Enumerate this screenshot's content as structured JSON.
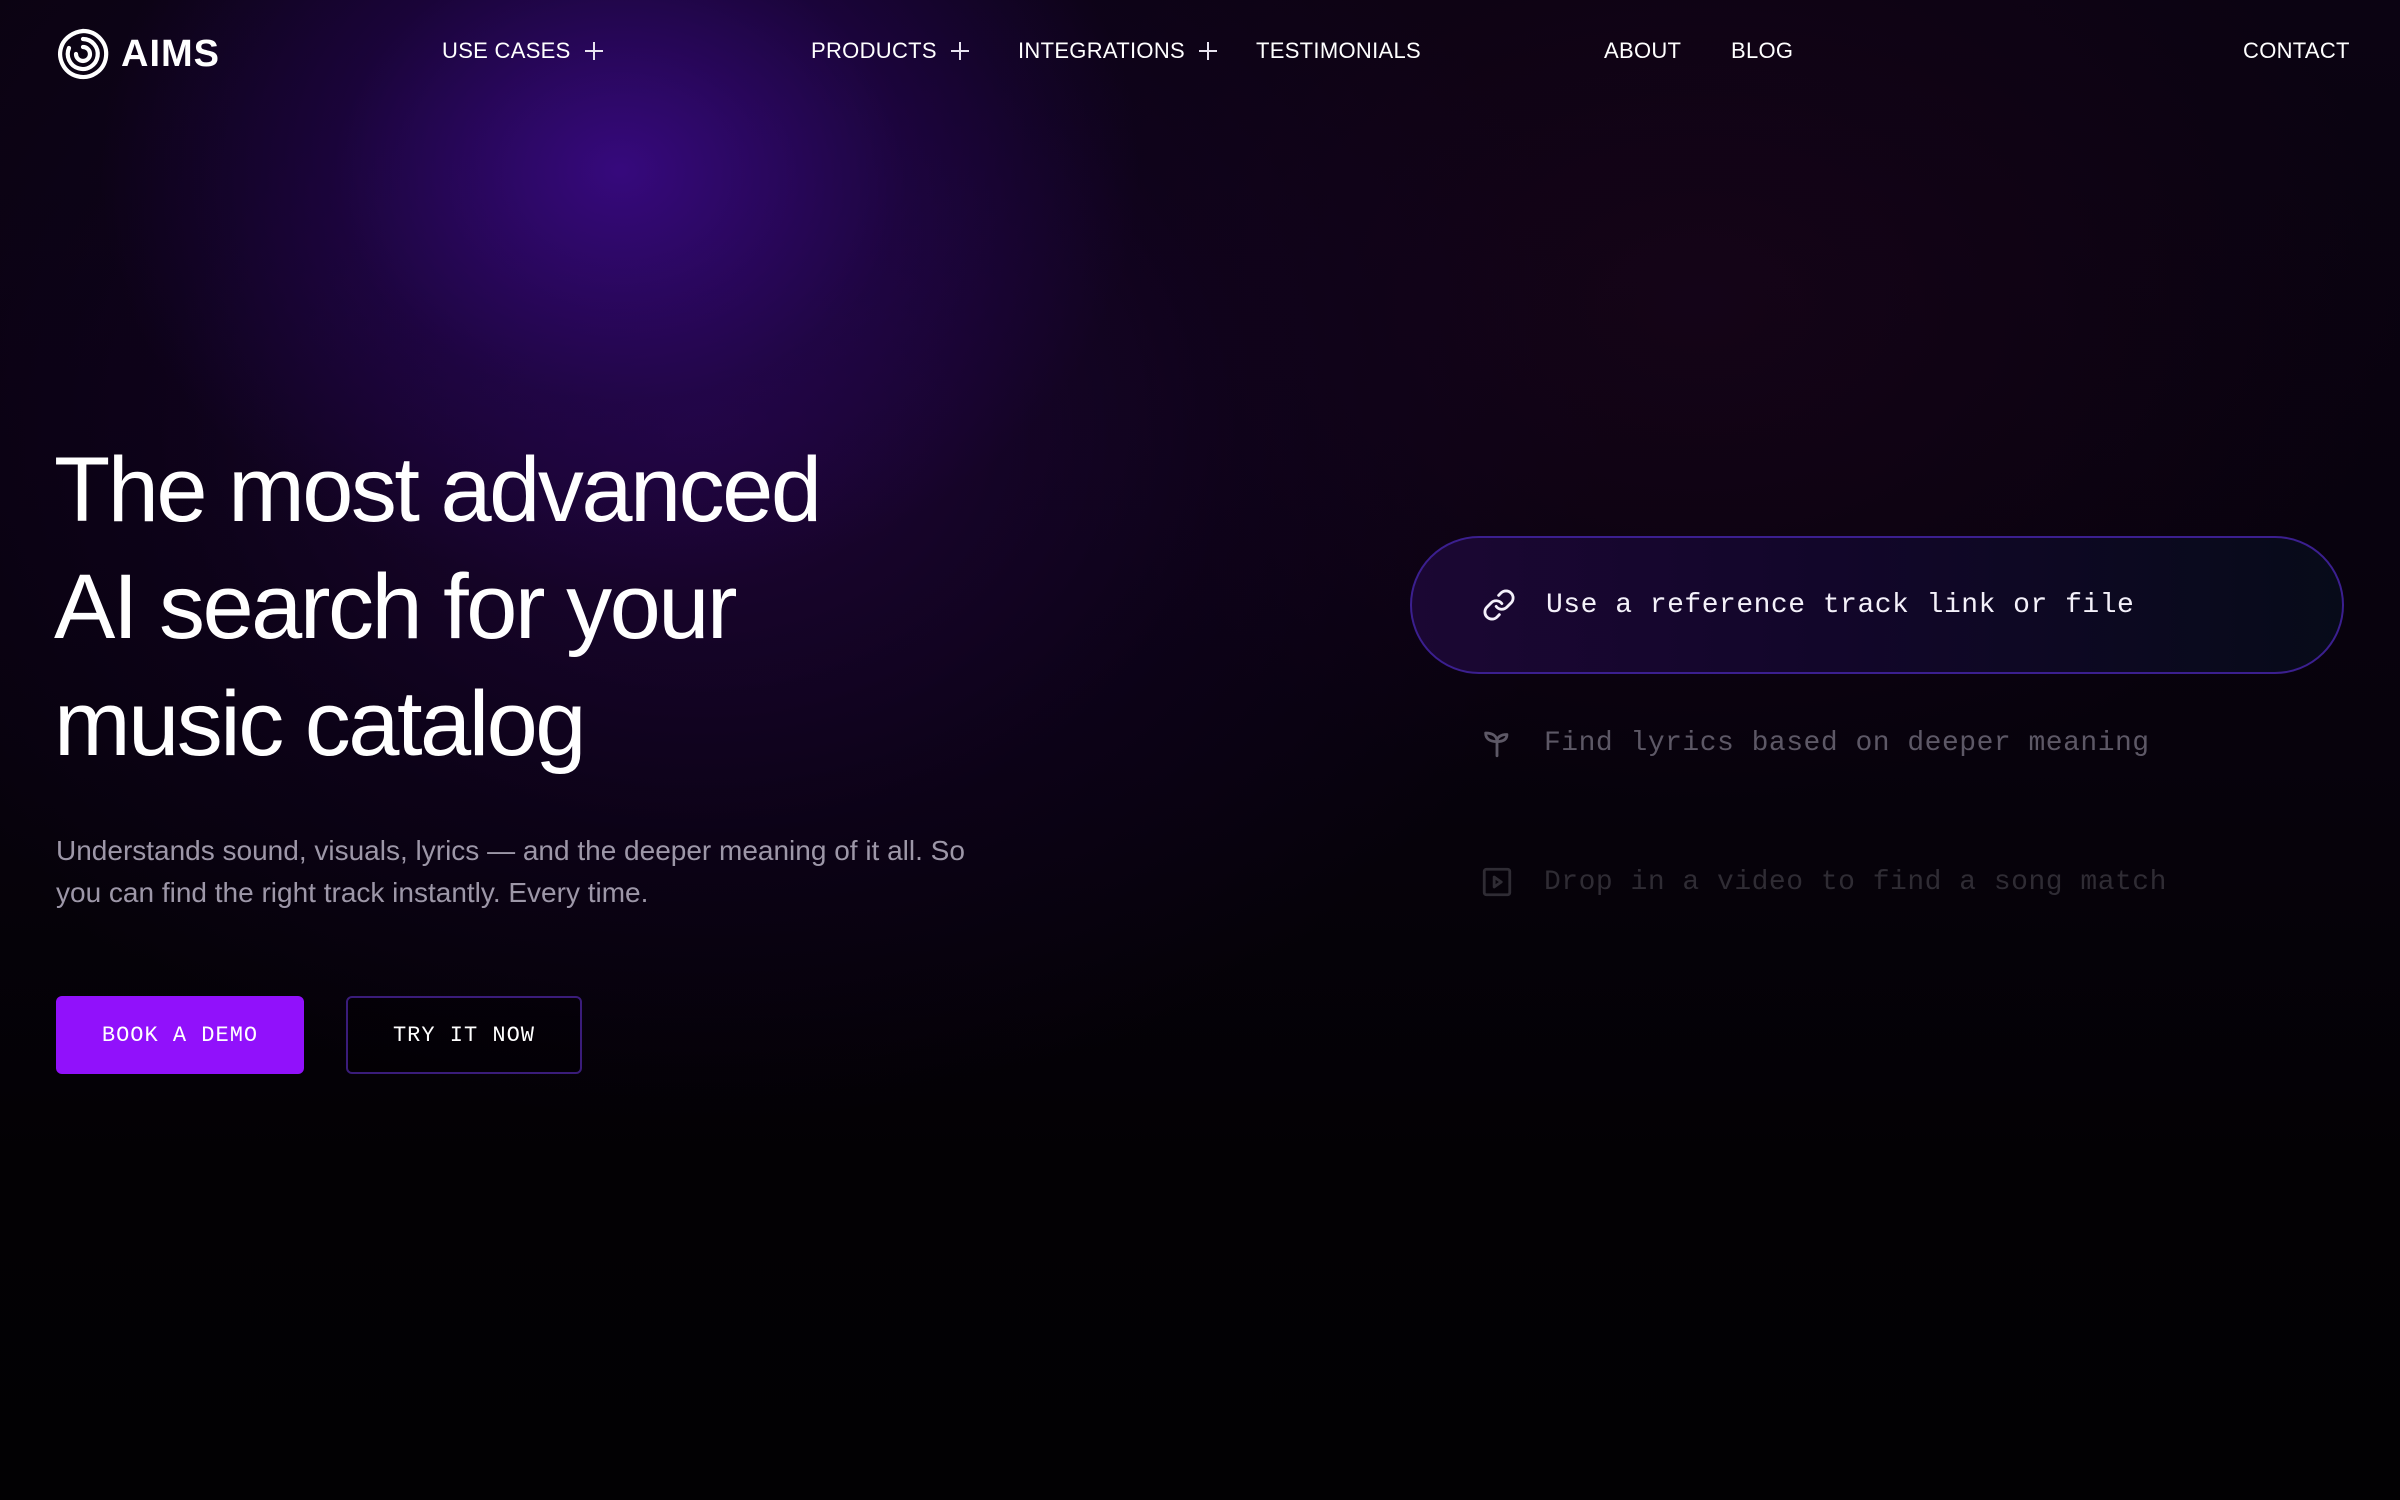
{
  "brand": {
    "name": "AIMS",
    "accent": "#9111fb",
    "logo_icon": "spiral-logo-icon"
  },
  "nav": {
    "items": [
      {
        "label": "USE CASES",
        "icon": "plus-icon"
      },
      {
        "label": "PRODUCTS",
        "icon": "plus-icon"
      },
      {
        "label": "INTEGRATIONS",
        "icon": "plus-icon"
      },
      {
        "label": "TESTIMONIALS"
      },
      {
        "label": "ABOUT"
      },
      {
        "label": "BLOG"
      },
      {
        "label": "CONTACT"
      }
    ]
  },
  "hero": {
    "title_lines": [
      "The most advanced",
      "AI search for your",
      "music catalog"
    ],
    "subtitle": "Understands sound, visuals, lyrics — and the deeper meaning of it all. So you can find the right track instantly. Every time.",
    "primary_cta": "BOOK A DEMO",
    "secondary_cta": "TRY IT NOW"
  },
  "search_options": [
    {
      "label": "Use a reference track link or file",
      "icon": "link-icon",
      "active": true
    },
    {
      "label": "Find lyrics based on deeper meaning",
      "icon": "sprout-icon",
      "active": false
    },
    {
      "label": "Drop in a video to find a song match",
      "icon": "video-play-icon",
      "active": false
    }
  ]
}
